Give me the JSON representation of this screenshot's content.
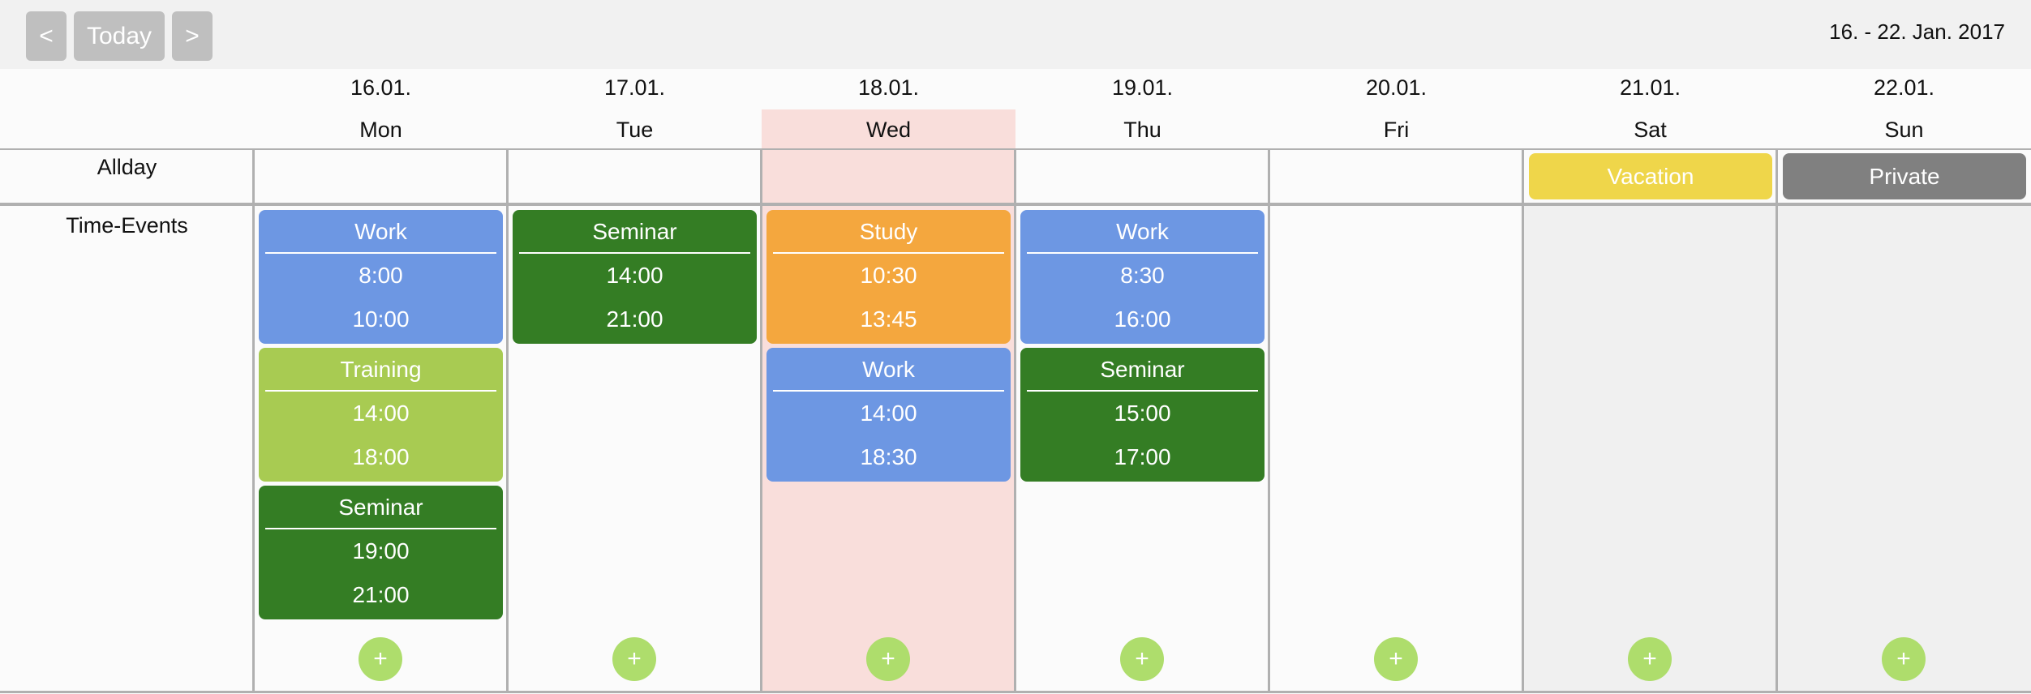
{
  "toolbar": {
    "prev_label": "<",
    "today_label": "Today",
    "next_label": ">",
    "date_range": "16. - 22. Jan. 2017"
  },
  "rows": {
    "allday_label": "Allday",
    "time_label": "Time-Events"
  },
  "colors": {
    "today_highlight": "#f9dedb",
    "weekend_bg": "#f0f0f0",
    "add_button": "#aedd6c"
  },
  "days": [
    {
      "date": "16.01.",
      "day": "Mon",
      "today": false,
      "weekend": false,
      "allday": null,
      "events": [
        {
          "title": "Work",
          "start": "8:00",
          "end": "10:00",
          "color": "#6d97e3"
        },
        {
          "title": "Training",
          "start": "14:00",
          "end": "18:00",
          "color": "#a8cb52"
        },
        {
          "title": "Seminar",
          "start": "19:00",
          "end": "21:00",
          "color": "#347d24"
        }
      ]
    },
    {
      "date": "17.01.",
      "day": "Tue",
      "today": false,
      "weekend": false,
      "allday": null,
      "events": [
        {
          "title": "Seminar",
          "start": "14:00",
          "end": "21:00",
          "color": "#347d24"
        }
      ]
    },
    {
      "date": "18.01.",
      "day": "Wed",
      "today": true,
      "weekend": false,
      "allday": null,
      "events": [
        {
          "title": "Study",
          "start": "10:30",
          "end": "13:45",
          "color": "#f4a73e"
        },
        {
          "title": "Work",
          "start": "14:00",
          "end": "18:30",
          "color": "#6d97e3"
        }
      ]
    },
    {
      "date": "19.01.",
      "day": "Thu",
      "today": false,
      "weekend": false,
      "allday": null,
      "events": [
        {
          "title": "Work",
          "start": "8:30",
          "end": "16:00",
          "color": "#6d97e3"
        },
        {
          "title": "Seminar",
          "start": "15:00",
          "end": "17:00",
          "color": "#347d24"
        }
      ]
    },
    {
      "date": "20.01.",
      "day": "Fri",
      "today": false,
      "weekend": false,
      "allday": null,
      "events": []
    },
    {
      "date": "21.01.",
      "day": "Sat",
      "today": false,
      "weekend": true,
      "allday": {
        "title": "Vacation",
        "color": "#efd64a"
      },
      "events": []
    },
    {
      "date": "22.01.",
      "day": "Sun",
      "today": false,
      "weekend": true,
      "allday": {
        "title": "Private",
        "color": "#808080"
      },
      "events": []
    }
  ],
  "add_label": "+"
}
